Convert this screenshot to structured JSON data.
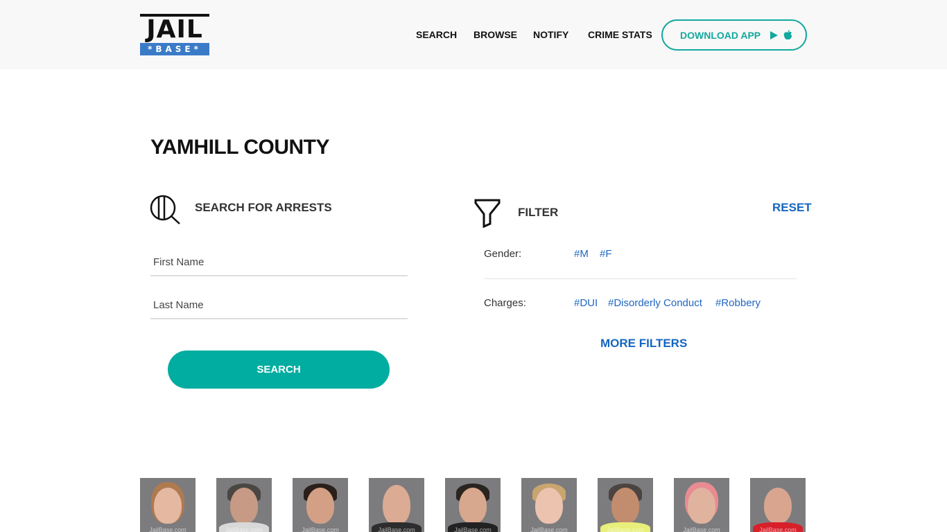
{
  "header": {
    "logo_top": "JAIL",
    "logo_bottom": "*BASE*",
    "nav": [
      "SEARCH",
      "BROWSE",
      "NOTIFY",
      "CRIME STATS"
    ],
    "download_label": "DOWNLOAD APP",
    "accent": "#13a89e"
  },
  "page": {
    "title": "YAMHILL COUNTY"
  },
  "search": {
    "heading": "SEARCH FOR ARRESTS",
    "first_name_placeholder": "First Name",
    "last_name_placeholder": "Last Name",
    "first_name_value": "",
    "last_name_value": "",
    "button_label": "SEARCH",
    "button_color": "#00ada0"
  },
  "filter": {
    "heading": "FILTER",
    "reset_label": "RESET",
    "gender_label": "Gender:",
    "gender_tags": [
      "#M",
      "#F"
    ],
    "charges_label": "Charges:",
    "charge_tags": [
      "#DUI",
      "#Disorderly Conduct",
      "#Robbery"
    ],
    "more_label": "MORE FILTERS",
    "link_color": "#1565c0"
  },
  "mugshots": {
    "watermark": "JailBase.com",
    "count": 9
  }
}
